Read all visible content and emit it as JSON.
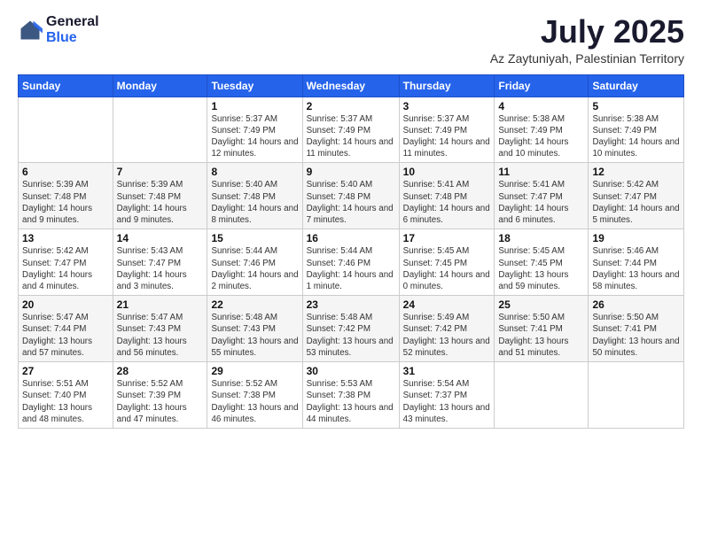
{
  "logo": {
    "general": "General",
    "blue": "Blue"
  },
  "header": {
    "month_year": "July 2025",
    "location": "Az Zaytuniyah, Palestinian Territory"
  },
  "days_of_week": [
    "Sunday",
    "Monday",
    "Tuesday",
    "Wednesday",
    "Thursday",
    "Friday",
    "Saturday"
  ],
  "weeks": [
    [
      {
        "day": "",
        "info": ""
      },
      {
        "day": "",
        "info": ""
      },
      {
        "day": "1",
        "info": "Sunrise: 5:37 AM\nSunset: 7:49 PM\nDaylight: 14 hours and 12 minutes."
      },
      {
        "day": "2",
        "info": "Sunrise: 5:37 AM\nSunset: 7:49 PM\nDaylight: 14 hours and 11 minutes."
      },
      {
        "day": "3",
        "info": "Sunrise: 5:37 AM\nSunset: 7:49 PM\nDaylight: 14 hours and 11 minutes."
      },
      {
        "day": "4",
        "info": "Sunrise: 5:38 AM\nSunset: 7:49 PM\nDaylight: 14 hours and 10 minutes."
      },
      {
        "day": "5",
        "info": "Sunrise: 5:38 AM\nSunset: 7:49 PM\nDaylight: 14 hours and 10 minutes."
      }
    ],
    [
      {
        "day": "6",
        "info": "Sunrise: 5:39 AM\nSunset: 7:48 PM\nDaylight: 14 hours and 9 minutes."
      },
      {
        "day": "7",
        "info": "Sunrise: 5:39 AM\nSunset: 7:48 PM\nDaylight: 14 hours and 9 minutes."
      },
      {
        "day": "8",
        "info": "Sunrise: 5:40 AM\nSunset: 7:48 PM\nDaylight: 14 hours and 8 minutes."
      },
      {
        "day": "9",
        "info": "Sunrise: 5:40 AM\nSunset: 7:48 PM\nDaylight: 14 hours and 7 minutes."
      },
      {
        "day": "10",
        "info": "Sunrise: 5:41 AM\nSunset: 7:48 PM\nDaylight: 14 hours and 6 minutes."
      },
      {
        "day": "11",
        "info": "Sunrise: 5:41 AM\nSunset: 7:47 PM\nDaylight: 14 hours and 6 minutes."
      },
      {
        "day": "12",
        "info": "Sunrise: 5:42 AM\nSunset: 7:47 PM\nDaylight: 14 hours and 5 minutes."
      }
    ],
    [
      {
        "day": "13",
        "info": "Sunrise: 5:42 AM\nSunset: 7:47 PM\nDaylight: 14 hours and 4 minutes."
      },
      {
        "day": "14",
        "info": "Sunrise: 5:43 AM\nSunset: 7:47 PM\nDaylight: 14 hours and 3 minutes."
      },
      {
        "day": "15",
        "info": "Sunrise: 5:44 AM\nSunset: 7:46 PM\nDaylight: 14 hours and 2 minutes."
      },
      {
        "day": "16",
        "info": "Sunrise: 5:44 AM\nSunset: 7:46 PM\nDaylight: 14 hours and 1 minute."
      },
      {
        "day": "17",
        "info": "Sunrise: 5:45 AM\nSunset: 7:45 PM\nDaylight: 14 hours and 0 minutes."
      },
      {
        "day": "18",
        "info": "Sunrise: 5:45 AM\nSunset: 7:45 PM\nDaylight: 13 hours and 59 minutes."
      },
      {
        "day": "19",
        "info": "Sunrise: 5:46 AM\nSunset: 7:44 PM\nDaylight: 13 hours and 58 minutes."
      }
    ],
    [
      {
        "day": "20",
        "info": "Sunrise: 5:47 AM\nSunset: 7:44 PM\nDaylight: 13 hours and 57 minutes."
      },
      {
        "day": "21",
        "info": "Sunrise: 5:47 AM\nSunset: 7:43 PM\nDaylight: 13 hours and 56 minutes."
      },
      {
        "day": "22",
        "info": "Sunrise: 5:48 AM\nSunset: 7:43 PM\nDaylight: 13 hours and 55 minutes."
      },
      {
        "day": "23",
        "info": "Sunrise: 5:48 AM\nSunset: 7:42 PM\nDaylight: 13 hours and 53 minutes."
      },
      {
        "day": "24",
        "info": "Sunrise: 5:49 AM\nSunset: 7:42 PM\nDaylight: 13 hours and 52 minutes."
      },
      {
        "day": "25",
        "info": "Sunrise: 5:50 AM\nSunset: 7:41 PM\nDaylight: 13 hours and 51 minutes."
      },
      {
        "day": "26",
        "info": "Sunrise: 5:50 AM\nSunset: 7:41 PM\nDaylight: 13 hours and 50 minutes."
      }
    ],
    [
      {
        "day": "27",
        "info": "Sunrise: 5:51 AM\nSunset: 7:40 PM\nDaylight: 13 hours and 48 minutes."
      },
      {
        "day": "28",
        "info": "Sunrise: 5:52 AM\nSunset: 7:39 PM\nDaylight: 13 hours and 47 minutes."
      },
      {
        "day": "29",
        "info": "Sunrise: 5:52 AM\nSunset: 7:38 PM\nDaylight: 13 hours and 46 minutes."
      },
      {
        "day": "30",
        "info": "Sunrise: 5:53 AM\nSunset: 7:38 PM\nDaylight: 13 hours and 44 minutes."
      },
      {
        "day": "31",
        "info": "Sunrise: 5:54 AM\nSunset: 7:37 PM\nDaylight: 13 hours and 43 minutes."
      },
      {
        "day": "",
        "info": ""
      },
      {
        "day": "",
        "info": ""
      }
    ]
  ]
}
